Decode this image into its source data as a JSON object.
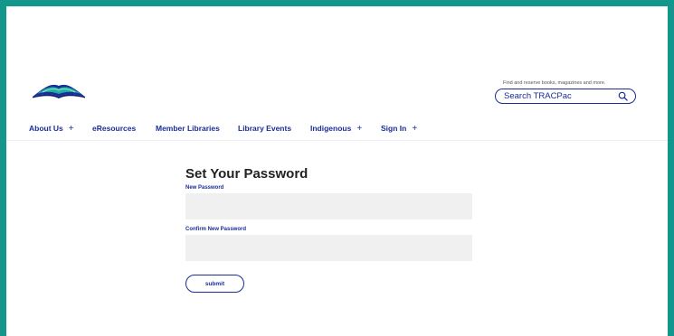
{
  "search": {
    "hint": "Find and reserve books, magazines and more.",
    "placeholder": "Search TRACPac"
  },
  "nav": {
    "items": [
      {
        "label": "About Us",
        "plus": "+"
      },
      {
        "label": "eResources"
      },
      {
        "label": "Member Libraries"
      },
      {
        "label": "Library Events"
      },
      {
        "label": "Indigenous",
        "plus": "+"
      },
      {
        "label": "Sign In",
        "plus": "+"
      }
    ]
  },
  "form": {
    "title": "Set Your Password",
    "new_password_label": "New Password",
    "confirm_password_label": "Confirm New Password",
    "new_password_value": "",
    "confirm_password_value": "",
    "submit_label": "submit"
  }
}
